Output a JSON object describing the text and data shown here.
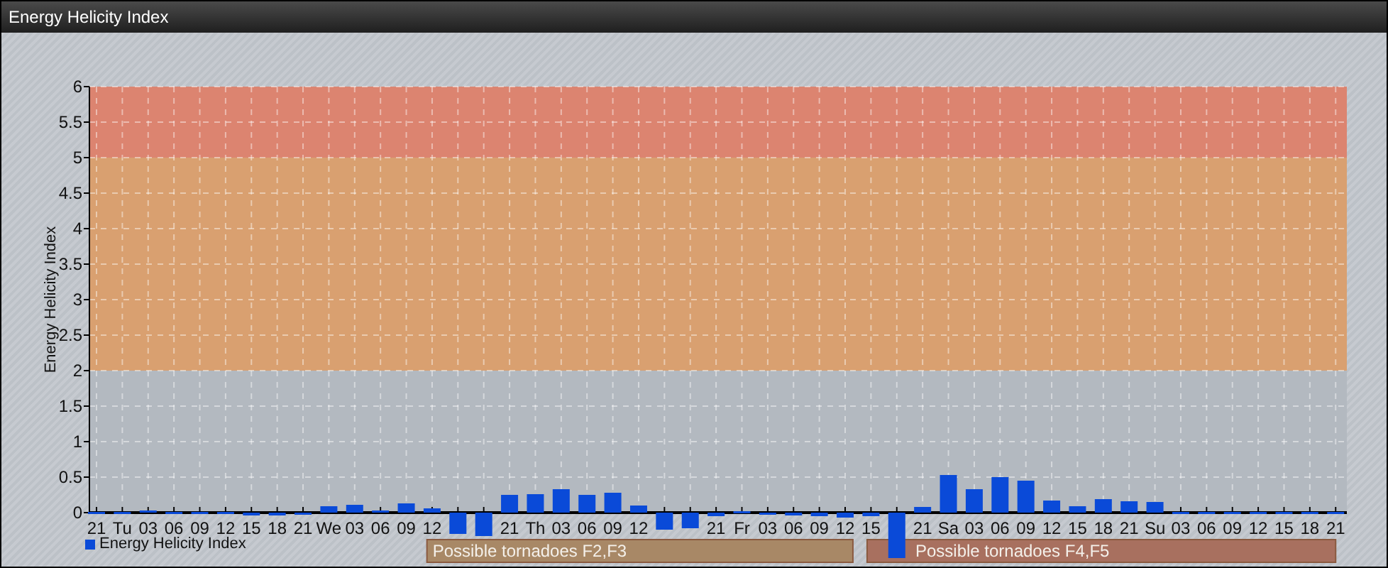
{
  "window": {
    "title": "Energy Helicity Index"
  },
  "chart": {
    "chart_data": {
      "type": "bar",
      "ylabel": "Energy Helicity Index",
      "categories": [
        "21",
        "Tu",
        "03",
        "06",
        "09",
        "12",
        "15",
        "18",
        "21",
        "We",
        "03",
        "06",
        "09",
        "12",
        null,
        null,
        "21",
        "Th",
        "03",
        "06",
        "09",
        "12",
        null,
        null,
        "21",
        "Fr",
        "03",
        "06",
        "09",
        "12",
        "15",
        null,
        "21",
        "Sa",
        "03",
        "06",
        "09",
        "12",
        "15",
        "18",
        "21",
        "Su",
        "03",
        "06",
        "09",
        "12",
        "15",
        "18",
        "21"
      ],
      "series": [
        {
          "name": "Energy Helicity Index",
          "color": "#0a4ad8",
          "values": [
            0.01,
            0.01,
            0.03,
            0.01,
            0.01,
            0.01,
            -0.04,
            -0.04,
            -0.03,
            0.09,
            0.11,
            0.03,
            0.13,
            0.06,
            -0.3,
            -0.33,
            0.25,
            0.26,
            0.33,
            0.25,
            0.28,
            0.1,
            -0.24,
            -0.22,
            -0.05,
            0.02,
            -0.03,
            -0.04,
            -0.05,
            -0.07,
            -0.05,
            -0.64,
            0.08,
            0.53,
            0.33,
            0.5,
            0.45,
            0.17,
            0.09,
            0.19,
            0.16,
            0.15,
            0.01,
            0.01,
            0.01,
            0.01,
            0.01,
            0.01,
            0.01
          ]
        }
      ],
      "ylim": [
        -0.7,
        6
      ],
      "yticks": [
        0,
        0.5,
        1,
        1.5,
        2,
        2.5,
        3,
        3.5,
        4,
        4.5,
        5,
        5.5,
        6
      ],
      "grid": true,
      "bands": [
        {
          "axis": "y",
          "from": 0,
          "to": 2,
          "color": "#b3b9c0"
        },
        {
          "axis": "y",
          "from": 2,
          "to": 5,
          "color": "#d9a070"
        },
        {
          "axis": "y",
          "from": 5,
          "to": 6,
          "color": "#dc8470"
        }
      ]
    },
    "tornado_labels": [
      {
        "text": "Possible tornadoes F2,F3",
        "color": "#a88866"
      },
      {
        "text": "Possible tornadoes F4,F5",
        "color": "#a8705f"
      }
    ]
  }
}
